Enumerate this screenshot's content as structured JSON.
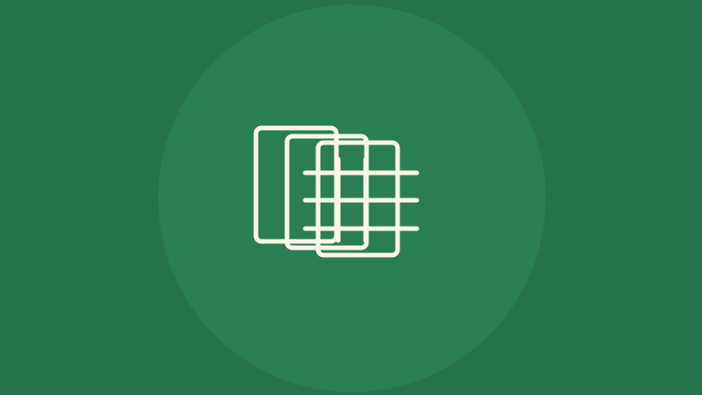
{
  "splash": {
    "background_color": "#26724b",
    "circle_color": "#2a7e55",
    "icon_color": "#fbf5e4",
    "icon": "stacked-pages-grid-icon"
  }
}
